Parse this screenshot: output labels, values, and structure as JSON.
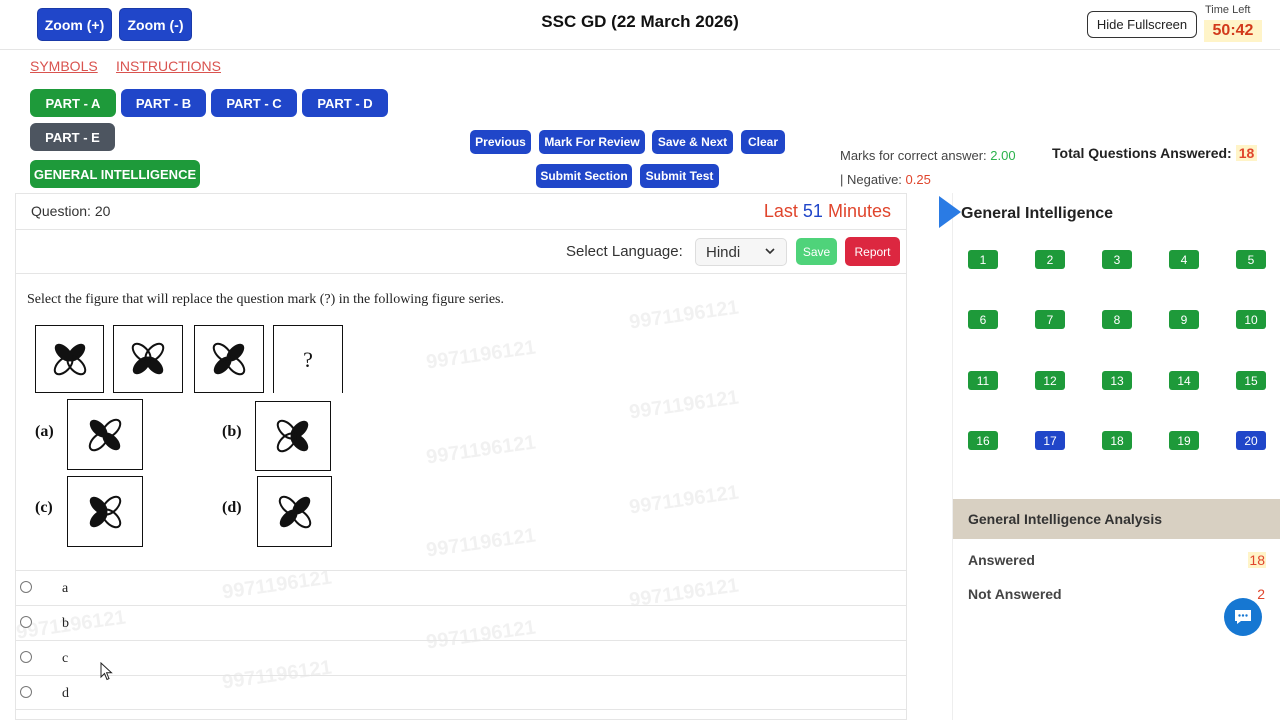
{
  "header": {
    "zoom_in": "Zoom (+)",
    "zoom_out": "Zoom (-)",
    "title": "SSC GD (22 March 2026)",
    "hide_fullscreen": "Hide Fullscreen",
    "time_left_label": "Time Left",
    "time_left": "50:42"
  },
  "links": {
    "symbols": "SYMBOLS",
    "instructions": "INSTRUCTIONS"
  },
  "parts": [
    "PART - A",
    "PART - B",
    "PART - C",
    "PART - D",
    "PART - E"
  ],
  "section": "GENERAL INTELLIGENCE",
  "controls": {
    "previous": "Previous",
    "mark_review": "Mark For Review",
    "save_next": "Save & Next",
    "clear": "Clear",
    "submit_section": "Submit Section",
    "submit_test": "Submit Test"
  },
  "marks": {
    "correct_label": "Marks for correct answer:",
    "correct_value": "2.00",
    "negative_label": "| Negative:",
    "negative_value": "0.25",
    "total_answered_label": "Total Questions Answered:",
    "total_answered_value": "18"
  },
  "question": {
    "number_label": "Question: 20",
    "last_prefix": "Last",
    "last_num": "51",
    "last_suffix": "Minutes",
    "select_language_label": "Select Language:",
    "language": "Hindi",
    "save": "Save",
    "report": "Report",
    "text": "Select the figure that will replace the question mark (?) in the following figure series.",
    "question_mark": "?",
    "figure_labels": [
      "(a)",
      "(b)",
      "(c)",
      "(d)"
    ],
    "options": [
      "a",
      "b",
      "c",
      "d"
    ]
  },
  "watermark": "9971196121",
  "right_panel": {
    "title": "General Intelligence",
    "questions": [
      {
        "n": "1",
        "status": "answered"
      },
      {
        "n": "2",
        "status": "answered"
      },
      {
        "n": "3",
        "status": "answered"
      },
      {
        "n": "4",
        "status": "answered"
      },
      {
        "n": "5",
        "status": "answered"
      },
      {
        "n": "6",
        "status": "answered"
      },
      {
        "n": "7",
        "status": "answered"
      },
      {
        "n": "8",
        "status": "answered"
      },
      {
        "n": "9",
        "status": "answered"
      },
      {
        "n": "10",
        "status": "answered"
      },
      {
        "n": "11",
        "status": "answered"
      },
      {
        "n": "12",
        "status": "answered"
      },
      {
        "n": "13",
        "status": "answered"
      },
      {
        "n": "14",
        "status": "answered"
      },
      {
        "n": "15",
        "status": "answered"
      },
      {
        "n": "16",
        "status": "answered"
      },
      {
        "n": "17",
        "status": "not-answered"
      },
      {
        "n": "18",
        "status": "answered"
      },
      {
        "n": "19",
        "status": "answered"
      },
      {
        "n": "20",
        "status": "not-answered"
      }
    ],
    "analysis_title": "General Intelligence Analysis",
    "answered_label": "Answered",
    "answered_value": "18",
    "not_answered_label": "Not Answered",
    "not_answered_value": "2"
  },
  "colors": {
    "primary_blue": "#2046c9",
    "answered_green": "#1e9a3a",
    "accent_red": "#e0452c",
    "report_red": "#dc2740"
  },
  "icons": [
    "flower-figure-icon",
    "chat-icon",
    "chevron-down-icon",
    "play-arrow-icon",
    "mouse-cursor-icon"
  ]
}
